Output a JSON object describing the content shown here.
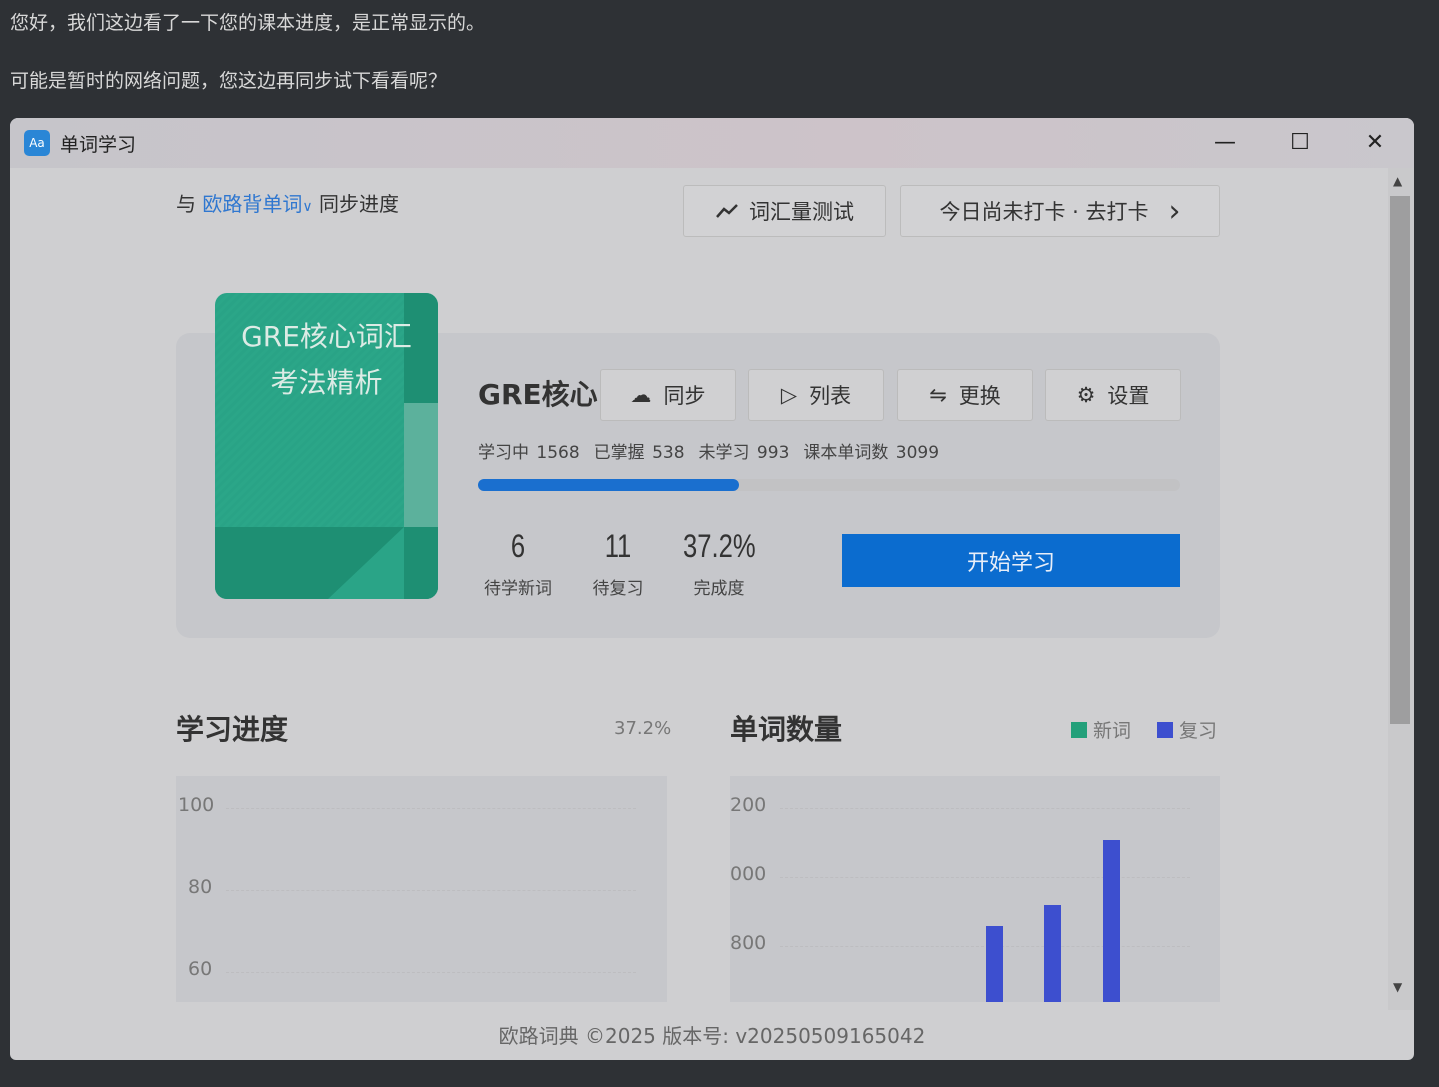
{
  "chat": {
    "line1": "您好，我们这边看了一下您的课本进度，是正常显示的。",
    "line2": "可能是暂时的网络问题，您这边再同步试下看看呢？"
  },
  "window": {
    "title": "单词学习",
    "icon_text": "Aa",
    "minimize": "—",
    "maximize": "☐",
    "close": "✕"
  },
  "sync": {
    "prefix": "与",
    "source": "欧路背单词",
    "chevron": "∨",
    "suffix": "同步进度"
  },
  "toolbar": {
    "vocab_test": "词汇量测试",
    "checkin": "今日尚未打卡 · 去打卡",
    "checkin_arrow": "›"
  },
  "book": {
    "cover_line1": "GRE核心词汇",
    "cover_line2": "考法精析",
    "name": "GRE核心",
    "actions": [
      {
        "icon": "cloud-sync-icon",
        "glyph": "☁",
        "label": "同步"
      },
      {
        "icon": "play-circle-icon",
        "glyph": "▷",
        "label": "列表"
      },
      {
        "icon": "swap-icon",
        "glyph": "⇋",
        "label": "更换"
      },
      {
        "icon": "gear-icon",
        "glyph": "⚙",
        "label": "设置"
      }
    ],
    "stats": {
      "learning": "学习中 1568",
      "mastered": "已掌握 538",
      "unlearned": "未学习 993",
      "total": "课本单词数 3099"
    },
    "progress_percent": 37.2,
    "counters": [
      {
        "value": "6",
        "label": "待学新词"
      },
      {
        "value": "11",
        "label": "待复习"
      },
      {
        "value": "37.2%",
        "label": "完成度"
      }
    ],
    "start_label": "开始学习"
  },
  "colors": {
    "accent": "#0b6ccf",
    "new_word": "#23a07a",
    "review": "#3d4fcf"
  },
  "chart_data": [
    {
      "type": "line",
      "title": "学习进度",
      "summary": "37.2%",
      "y_ticks": [
        "100",
        "80",
        "60"
      ],
      "grid": true
    },
    {
      "type": "bar",
      "title": "单词数量",
      "legend": [
        {
          "name": "新词",
          "color": "#23a07a"
        },
        {
          "name": "复习",
          "color": "#3d4fcf"
        }
      ],
      "legend_position": "top-right",
      "y_ticks": [
        "200",
        "000",
        "800"
      ],
      "ylim_visible": [
        700,
        1300
      ],
      "grid": true,
      "series": [
        {
          "name": "复习",
          "values": [
            858,
            919,
            1107
          ]
        }
      ]
    }
  ],
  "footer": "欧路词典 ©2025 版本号: v20250509165042"
}
